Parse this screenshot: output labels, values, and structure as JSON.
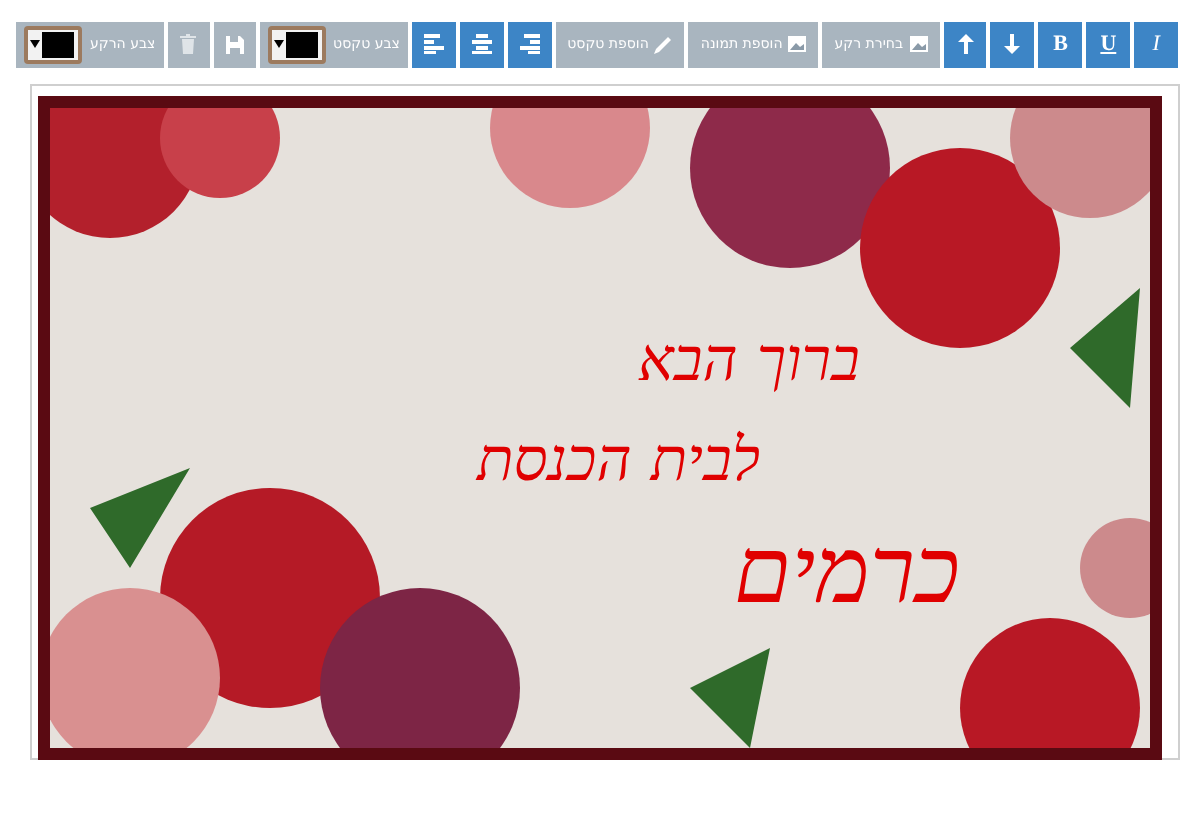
{
  "toolbar": {
    "items": [
      {
        "kind": "style",
        "label": "I"
      },
      {
        "kind": "style",
        "label": "U"
      },
      {
        "kind": "style",
        "label": "B"
      },
      {
        "kind": "icon"
      },
      {
        "kind": "icon"
      },
      {
        "kind": "text",
        "label": "בחירת רקע"
      },
      {
        "kind": "text",
        "label": "הוספת תמונה"
      },
      {
        "kind": "text",
        "label": "הוספת טקסט"
      },
      {
        "kind": "icon"
      },
      {
        "kind": "icon"
      },
      {
        "kind": "icon"
      },
      {
        "kind": "color",
        "label": "צבע טקסט",
        "color": "#000000"
      },
      {
        "kind": "plain"
      },
      {
        "kind": "plain"
      },
      {
        "kind": "color",
        "label": "צבע הרקע",
        "color": "#000000"
      }
    ]
  },
  "canvas": {
    "texts": [
      {
        "text": "ברוך הבא"
      },
      {
        "text": "לבית הכנסת"
      },
      {
        "text": "כרמים"
      }
    ]
  }
}
